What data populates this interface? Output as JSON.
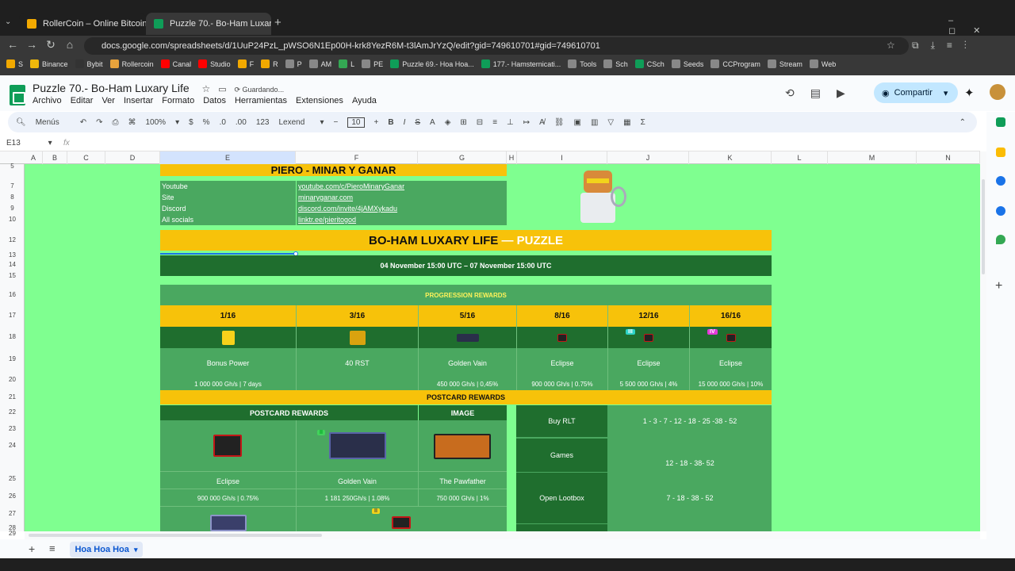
{
  "browser": {
    "tabs": [
      {
        "label": "RollerCoin – Online Bitcoin Min",
        "color": "#f2a900"
      },
      {
        "label": "Puzzle 70.- Bo-Ham Luxary Life",
        "color": "#0f9d58"
      }
    ],
    "url": "docs.google.com/spreadsheets/d/1UuP24PzL_pWSO6N1Ep00H-krk8YezR6M-t3lAmJrYzQ/edit?gid=749610701#gid=749610701",
    "bookmarks": [
      "S",
      "Binance",
      "Bybit",
      "Rollercoin",
      "Canal",
      "Studio",
      "F",
      "R",
      "P",
      "AM",
      "L",
      "PE",
      "Puzzle 69.- Hoa Hoa...",
      "177.- Hamsternicati...",
      "Tools",
      "Sch",
      "CSch",
      "Seeds",
      "CCProgram",
      "Stream",
      "Web"
    ]
  },
  "doc": {
    "title": "Puzzle 70.- Bo-Ham Luxary Life",
    "saving": "Guardando...",
    "menu": [
      "Archivo",
      "Editar",
      "Ver",
      "Insertar",
      "Formato",
      "Datos",
      "Herramientas",
      "Extensiones",
      "Ayuda"
    ],
    "share": "Compartir",
    "toolbar": {
      "search": "Menús",
      "zoom": "100%",
      "currency": "$",
      "percent": "%",
      "dec_less": ".0",
      "dec_more": ".00",
      "number_fmt": "123",
      "font": "Lexend",
      "font_size": "10"
    },
    "name_box": "E13",
    "fx": "fx"
  },
  "grid": {
    "columns": [
      "A",
      "B",
      "C",
      "D",
      "E",
      "F",
      "G",
      "H",
      "I",
      "J",
      "K",
      "L",
      "M",
      "N"
    ],
    "rows": [
      "5",
      "7",
      "8",
      "9",
      "10",
      "12",
      "13",
      "14",
      "15",
      "16",
      "17",
      "18",
      "19",
      "20",
      "21",
      "22",
      "23",
      "24",
      "25",
      "26",
      "27",
      "28",
      "29"
    ]
  },
  "sheet": {
    "header": "PIERO - MINAR Y GANAR",
    "links": [
      {
        "label": "Youtube",
        "value": "youtube.com/c/PieroMinaryGanar"
      },
      {
        "label": "Site",
        "value": "minaryganar.com"
      },
      {
        "label": "Discord",
        "value": "discord.com/invite/4jAMXykadu"
      },
      {
        "label": "All socials",
        "value": "linktr.ee/pieritogod"
      }
    ],
    "puzzle_title": "BO-HAM LUXARY LIFE",
    "puzzle_suffix": "— PUZZLE",
    "dates": "04 November 15:00 UTC – 07 November 15:00 UTC",
    "progression_header": "PROGRESSION REWARDS",
    "progression": [
      {
        "step": "1/16",
        "name": "Bonus Power",
        "detail": "1 000 000 Gh/s | 7 days"
      },
      {
        "step": "3/16",
        "name": "40 RST",
        "detail": ""
      },
      {
        "step": "5/16",
        "name": "Golden Vain",
        "detail": "450 000 Gh/s | 0,45%"
      },
      {
        "step": "8/16",
        "name": "Eclipse",
        "detail": "900 000 Gh/s | 0.75%"
      },
      {
        "step": "12/16",
        "name": "Eclipse",
        "detail": "5 500 000 Gh/s | 4%",
        "badge": "III"
      },
      {
        "step": "16/16",
        "name": "Eclipse",
        "detail": "15 000 000 Gh/s | 10%",
        "badge": "IV"
      }
    ],
    "postcard_header": "POSTCARD REWARDS",
    "postcard_col": "POSTCARD REWARDS",
    "image_col": "IMAGE",
    "postcards": [
      {
        "name": "Eclipse",
        "detail": "900 000 Gh/s | 0.75%"
      },
      {
        "name": "Golden Vain",
        "detail": "1 181 250Gh/s | 1.08%",
        "badge": "II"
      },
      {
        "name": "The Pawfather",
        "detail": "750 000 Gh/s | 1%"
      }
    ],
    "sources": [
      {
        "label": "Buy RLT",
        "value": "1 - 3 - 7  - 12 - 18 - 25 -38 - 52"
      },
      {
        "label": "Games",
        "value": "12 - 18 - 38- 52"
      },
      {
        "label": "Open Lootbox",
        "value": "7 - 18 - 38 - 52"
      }
    ],
    "row28_badge": "II"
  },
  "sheet_tab": "Hoa Hoa Hoa"
}
